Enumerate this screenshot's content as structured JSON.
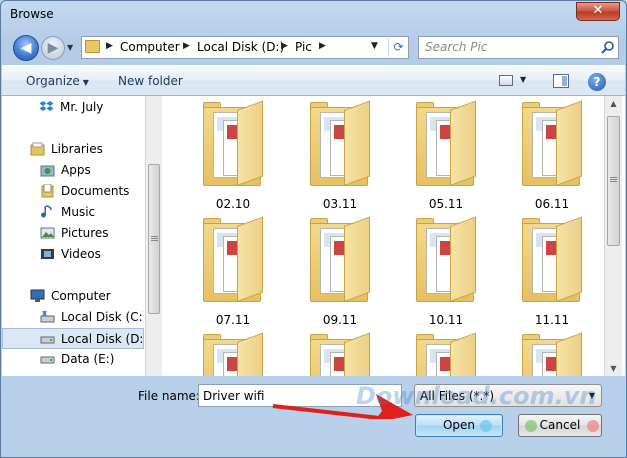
{
  "window": {
    "title": "Browse",
    "close_label": "✕"
  },
  "nav": {
    "breadcrumbs": [
      "Computer",
      "Local Disk (D:)",
      "Pic"
    ],
    "search_placeholder": "Search Pic"
  },
  "toolbar": {
    "organize_label": "Organize",
    "new_folder_label": "New folder",
    "help_label": "?"
  },
  "sidebar": {
    "items": [
      {
        "label": "Mr. July",
        "icon": "dropbox-icon"
      },
      {
        "label": "Libraries",
        "icon": "libraries-icon"
      },
      {
        "label": "Apps",
        "icon": "apps-icon"
      },
      {
        "label": "Documents",
        "icon": "documents-icon"
      },
      {
        "label": "Music",
        "icon": "music-icon"
      },
      {
        "label": "Pictures",
        "icon": "pictures-icon"
      },
      {
        "label": "Videos",
        "icon": "videos-icon"
      },
      {
        "label": "Computer",
        "icon": "computer-icon"
      },
      {
        "label": "Local Disk (C:)",
        "icon": "drive-icon"
      },
      {
        "label": "Local Disk (D:)",
        "icon": "drive-icon",
        "selected": true
      },
      {
        "label": "Data (E:)",
        "icon": "drive-icon"
      }
    ]
  },
  "files": [
    {
      "label": "02.10"
    },
    {
      "label": "03.11"
    },
    {
      "label": "05.11"
    },
    {
      "label": "06.11"
    },
    {
      "label": "07.11"
    },
    {
      "label": "09.11"
    },
    {
      "label": "10.11"
    },
    {
      "label": "11.11"
    },
    {
      "label": ""
    },
    {
      "label": ""
    },
    {
      "label": ""
    },
    {
      "label": ""
    }
  ],
  "bottom": {
    "filename_label": "File name:",
    "filename_value": "Driver wifi",
    "filetype_value": "All Files (*.*)",
    "open_label": "Open",
    "cancel_label": "Cancel"
  },
  "watermark": "Download.com.vn",
  "colors": {
    "accent_arrow": "#e0201a",
    "selection": "#dce7f5"
  }
}
